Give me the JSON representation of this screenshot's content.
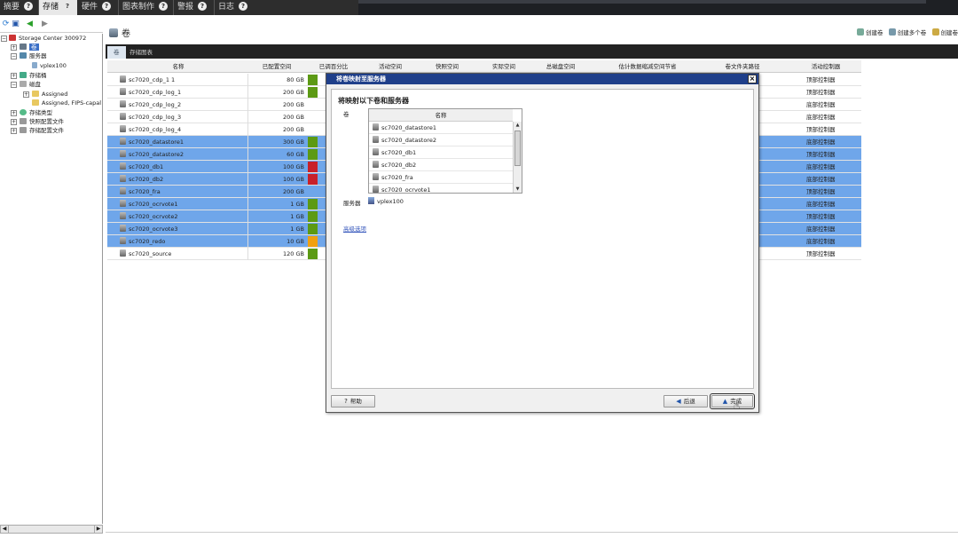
{
  "menu": {
    "tabs": [
      {
        "label": "摘要"
      },
      {
        "label": "存储"
      },
      {
        "label": "硬件"
      },
      {
        "label": "图表制作"
      },
      {
        "label": "警报"
      },
      {
        "label": "日志"
      }
    ],
    "help_glyph": "?"
  },
  "tree": {
    "root": "Storage Center 300972",
    "volumes": "卷",
    "servers": "服务器",
    "server_child": "vplex100",
    "storage_type": "存储桶",
    "disks": "磁盘",
    "disk_assigned": "Assigned",
    "disk_fips": "Assigned, FIPS-capal",
    "storage_types": "存储类型",
    "snapshot_profiles": "快照配置文件",
    "storage_profiles": "存储配置文件"
  },
  "main": {
    "title": "卷",
    "actions": [
      "创建卷",
      "创建多个卷",
      "创建卷"
    ],
    "tabs": [
      "卷",
      "存储图表"
    ],
    "columns": [
      "名称",
      "已配置空间",
      "已调百分比",
      "活动空间",
      "快照空间",
      "实际空间",
      "总磁盘空间",
      "估计数据缩减空间节省",
      "卷文件夹路径",
      "活动控制器"
    ],
    "rows": [
      {
        "name": "sc7020_cdp_1 1",
        "size": "80 GB",
        "bar": "#5c9a14",
        "selected": false,
        "controller": "顶部控制器"
      },
      {
        "name": "sc7020_cdp_log_1",
        "size": "200 GB",
        "bar": "#5c9a14",
        "selected": false,
        "controller": "顶部控制器"
      },
      {
        "name": "sc7020_cdp_log_2",
        "size": "200 GB",
        "bar": "",
        "selected": false,
        "controller": "底部控制器"
      },
      {
        "name": "sc7020_cdp_log_3",
        "size": "200 GB",
        "bar": "",
        "selected": false,
        "controller": "底部控制器"
      },
      {
        "name": "sc7020_cdp_log_4",
        "size": "200 GB",
        "bar": "",
        "selected": false,
        "controller": "顶部控制器"
      },
      {
        "name": "sc7020_datastore1",
        "size": "300 GB",
        "bar": "#5c9a14",
        "selected": true,
        "controller": "底部控制器"
      },
      {
        "name": "sc7020_datastore2",
        "size": "60 GB",
        "bar": "#5c9a14",
        "selected": true,
        "controller": "顶部控制器"
      },
      {
        "name": "sc7020_db1",
        "size": "100 GB",
        "bar": "#c8202a",
        "selected": true,
        "controller": "底部控制器"
      },
      {
        "name": "sc7020_db2",
        "size": "100 GB",
        "bar": "#c8202a",
        "selected": true,
        "controller": "底部控制器"
      },
      {
        "name": "sc7020_fra",
        "size": "200 GB",
        "bar": "",
        "selected": true,
        "controller": "顶部控制器"
      },
      {
        "name": "sc7020_ocrvote1",
        "size": "1 GB",
        "bar": "#5c9a14",
        "selected": true,
        "controller": "底部控制器"
      },
      {
        "name": "sc7020_ocrvote2",
        "size": "1 GB",
        "bar": "#5c9a14",
        "selected": true,
        "controller": "顶部控制器"
      },
      {
        "name": "sc7020_ocrvote3",
        "size": "1 GB",
        "bar": "#5c9a14",
        "selected": true,
        "controller": "底部控制器"
      },
      {
        "name": "sc7020_redo",
        "size": "10 GB",
        "bar": "#f0a010",
        "selected": true,
        "controller": "底部控制器"
      },
      {
        "name": "sc7020_source",
        "size": "120 GB",
        "bar": "#5c9a14",
        "selected": false,
        "controller": "顶部控制器"
      }
    ]
  },
  "dialog": {
    "title": "将卷映射至服务器",
    "close": "×",
    "heading": "将映射以下卷和服务器",
    "volumes_label": "卷",
    "list_header": "名称",
    "list_items": [
      "sc7020_datastore1",
      "sc7020_datastore2",
      "sc7020_db1",
      "sc7020_db2",
      "sc7020_fra",
      "sc7020_ocrvote1"
    ],
    "server_label": "服务器",
    "server_value": "vplex100",
    "advanced_link": "高级选项",
    "help_button": "帮助",
    "back_button": "后退",
    "finish_button": "完成"
  },
  "colors": {
    "selected_row": "#6fa6ea",
    "title_bar": "#1f3f8a"
  },
  "icons": [
    "help-icon",
    "refresh-icon",
    "save-icon",
    "back-arrow-icon",
    "forward-arrow-icon",
    "volume-icon",
    "server-icon",
    "close-icon",
    "scroll-up-icon",
    "scroll-down-icon",
    "cursor-hand-icon"
  ]
}
